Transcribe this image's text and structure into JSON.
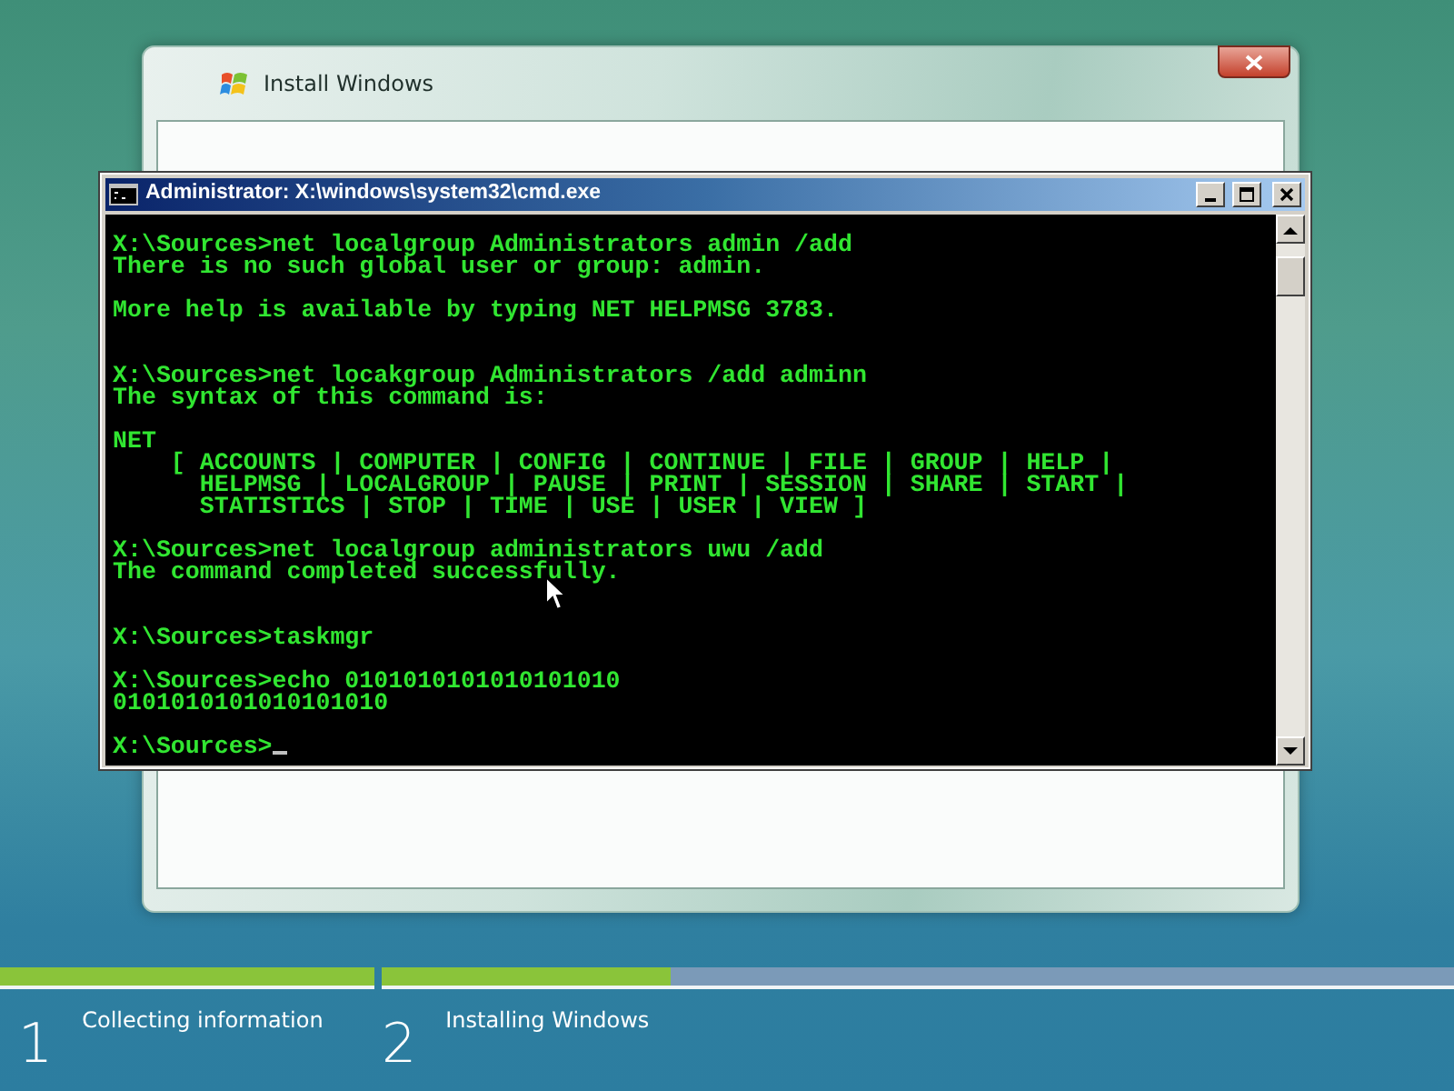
{
  "installer": {
    "title": "Install Windows",
    "steps": [
      {
        "number": "1",
        "label": "Collecting information",
        "level": 1
      },
      {
        "number": "2",
        "label": "Installing Windows",
        "level": 0.27
      }
    ]
  },
  "console": {
    "title": "Administrator: X:\\windows\\system32\\cmd.exe",
    "lines": [
      {
        "kind": "text",
        "text": "X:\\Sources>net localgroup Administrators admin /add"
      },
      {
        "kind": "text",
        "text": "There is no such global user or group: admin."
      },
      {
        "kind": "blank"
      },
      {
        "kind": "text",
        "text": "More help is available by typing NET HELPMSG 3783."
      },
      {
        "kind": "blank"
      },
      {
        "kind": "blank"
      },
      {
        "kind": "text",
        "text": "X:\\Sources>net locakgroup Administrators /add adminn"
      },
      {
        "kind": "text",
        "text": "The syntax of this command is:"
      },
      {
        "kind": "blank"
      },
      {
        "kind": "text",
        "text": "NET"
      },
      {
        "kind": "text",
        "text": "    [ ACCOUNTS | COMPUTER | CONFIG | CONTINUE | FILE | GROUP | HELP |"
      },
      {
        "kind": "text",
        "text": "      HELPMSG | LOCALGROUP | PAUSE | PRINT | SESSION | SHARE | START |"
      },
      {
        "kind": "text",
        "text": "      STATISTICS | STOP | TIME | USE | USER | VIEW ]"
      },
      {
        "kind": "blank"
      },
      {
        "kind": "text",
        "text": "X:\\Sources>net localgroup administrators uwu /add"
      },
      {
        "kind": "text",
        "text": "The command completed successfully."
      },
      {
        "kind": "blank"
      },
      {
        "kind": "blank"
      },
      {
        "kind": "text",
        "text": "X:\\Sources>taskmgr"
      },
      {
        "kind": "blank"
      },
      {
        "kind": "text",
        "text": "X:\\Sources>echo 0101010101010101010"
      },
      {
        "kind": "text",
        "text": "0101010101010101010"
      },
      {
        "kind": "blank"
      },
      {
        "kind": "prompt",
        "text": "X:\\Sources>"
      }
    ]
  }
}
